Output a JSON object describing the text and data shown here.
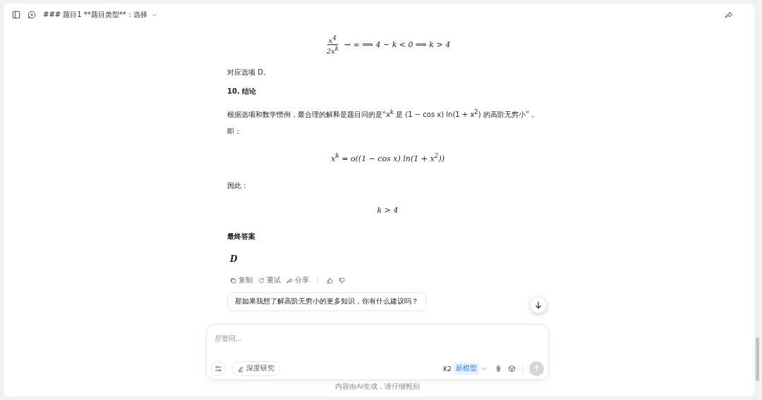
{
  "header": {
    "title": "### 题目1 **题目类型**：选择"
  },
  "blocks": [
    {
      "kind": "fraction",
      "numerator": "x$^{4}$",
      "denominator": "2x$^{k}$",
      "rest": "→ ∞ ⟹ 4 − k < 0 ⟹ k > 4"
    },
    {
      "kind": "paragraph",
      "text": "对应选项 D。"
    },
    {
      "kind": "heading",
      "text": "10. 结论"
    },
    {
      "kind": "paragraph",
      "text": "根据选项和数学惯例，最合理的解释是题目问的是“x$^{k}$ 是 (1 − cos x) ln(1 + x$^{2}$) 的高阶无穷小”，即："
    },
    {
      "kind": "formula",
      "text": "x$^{k}$ = o((1 − cos x) ln(1 + x$^{2}$))"
    },
    {
      "kind": "paragraph",
      "text": "因此："
    },
    {
      "kind": "formula",
      "text": "k > 4"
    },
    {
      "kind": "heading",
      "text": "最终答案"
    },
    {
      "kind": "answer",
      "text": "D"
    }
  ],
  "actions": [
    {
      "kind": "copy",
      "label": "复制"
    },
    {
      "kind": "retry",
      "label": "重试"
    },
    {
      "kind": "share",
      "label": "分享"
    },
    {
      "kind": "like"
    },
    {
      "kind": "dislike"
    }
  ],
  "suggestions": [
    "那如果我想了解高阶无穷小的更多知识，你有什么建议吗？"
  ],
  "composer": {
    "placeholder": "尽管问...",
    "deep_research": "深度研究",
    "model": "K2",
    "badge": "新模型"
  },
  "footer": "内容由AI生成，请仔细甄别"
}
